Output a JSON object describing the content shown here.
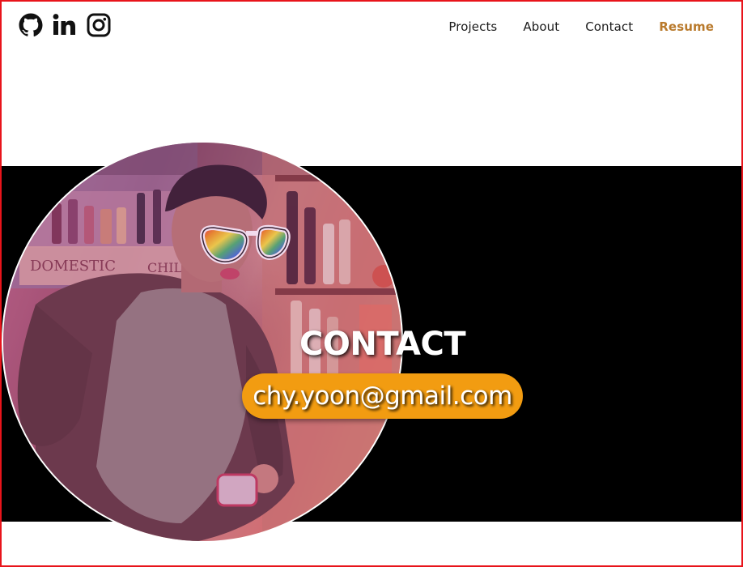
{
  "header": {
    "social": [
      {
        "icon": "github-icon"
      },
      {
        "icon": "linkedin-icon"
      },
      {
        "icon": "instagram-icon"
      }
    ],
    "nav": {
      "projects": "Projects",
      "about": "About",
      "contact": "Contact",
      "resume": "Resume"
    }
  },
  "hero": {
    "title": "CONTACT",
    "email": "chy.yoon@gmail.com",
    "photo_sign_1": "DOMESTIC",
    "photo_sign_2": "CHILLE"
  },
  "colors": {
    "accent": "#f29c11",
    "resume_link": "#b97a2c",
    "band": "#000000",
    "frame": "#e8141b"
  }
}
